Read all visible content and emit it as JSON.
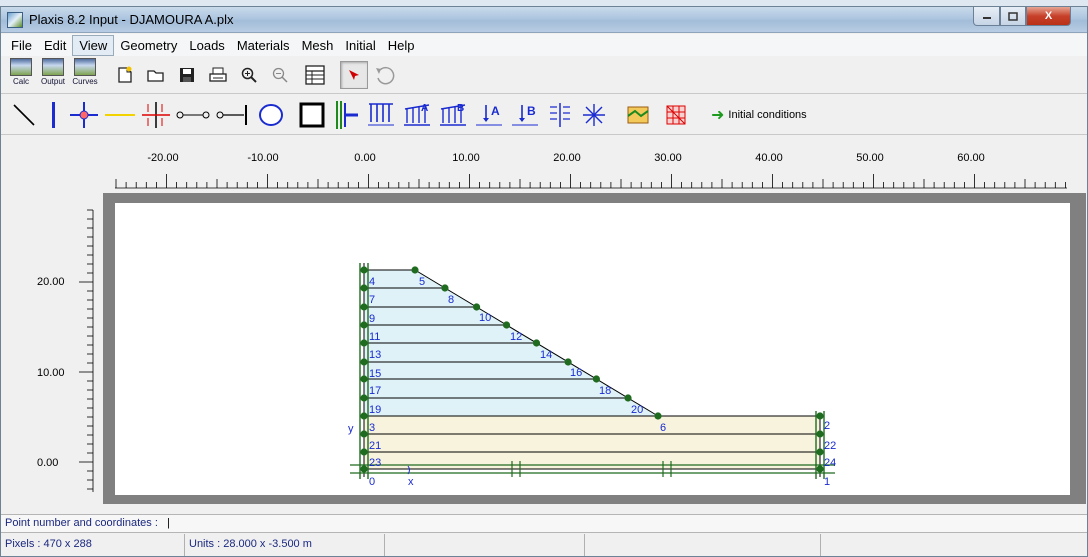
{
  "window": {
    "title": "Plaxis 8.2 Input - DJAMOURA A.plx",
    "close_glyph": "X"
  },
  "menu": [
    "File",
    "Edit",
    "View",
    "Geometry",
    "Loads",
    "Materials",
    "Mesh",
    "Initial",
    "Help"
  ],
  "toolbar1": {
    "calc_label": "Calc",
    "output_label": "Output",
    "curves_label": "Curves"
  },
  "toolbar2": {
    "initial_conditions_label": "Initial conditions"
  },
  "ruler": {
    "x_ticks": [
      "-20.00",
      "-10.00",
      "0.00",
      "10.00",
      "20.00",
      "30.00",
      "40.00",
      "50.00",
      "60.00"
    ],
    "y_ticks": [
      "20.00",
      "10.00",
      "0.00"
    ]
  },
  "geometry": {
    "point_labels": [
      "0",
      "1",
      "2",
      "3",
      "4",
      "5",
      "6",
      "7",
      "8",
      "9",
      "10",
      "11",
      "12",
      "13",
      "14",
      "15",
      "16",
      "17",
      "18",
      "19",
      "20",
      "21",
      "22",
      "23",
      "24"
    ],
    "axis_x_label": "x",
    "axis_y_label": "y",
    "colors": {
      "embankment": "#dff2f7",
      "foundation": "#f7f3dc",
      "line": "#000000",
      "node": "#1f6b1f",
      "label": "#1a2bd0",
      "fixity": "#1f6b1f"
    }
  },
  "info": {
    "point_label": "Point number and coordinates :",
    "value": "|"
  },
  "status": {
    "pixels": "Pixels : 470 x 288",
    "units": "Units : 28.000 x -3.500 m"
  }
}
